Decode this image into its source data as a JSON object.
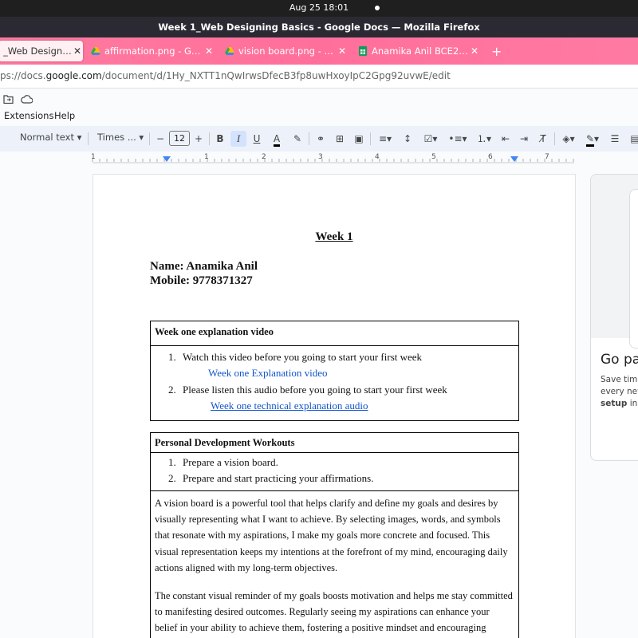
{
  "system": {
    "clock": "Aug 25  18:01"
  },
  "window": {
    "title": "Week 1_Web Designing Basics - Google Docs — Mozilla Firefox"
  },
  "tabs": [
    {
      "label": "_Web Designing B",
      "icon": "docs-icon",
      "active": true
    },
    {
      "label": "affirmation.png - Google",
      "icon": "drive-icon"
    },
    {
      "label": "vision board.png - Google",
      "icon": "drive-icon"
    },
    {
      "label": "Anamika Anil BCE210: Ma",
      "icon": "sheets-icon"
    }
  ],
  "urlbar": {
    "prefix": "ps://docs.",
    "domain": "google.com",
    "path": "/document/d/1Hy_NXTT1nQwIrwsDfecB3fp8uwHxoyIpC2Gpg92uvwE/edit"
  },
  "menus": [
    "Extensions",
    "Help"
  ],
  "toolbar": {
    "style": "Normal text",
    "font": "Times ...",
    "font_size": "12"
  },
  "ruler": {
    "numbers": [
      "1",
      "1",
      "2",
      "3",
      "4",
      "5",
      "6",
      "7"
    ]
  },
  "document": {
    "title": "Week 1",
    "name_line": "Name: Anamika Anil",
    "mobile_line": "Mobile: 9778371327",
    "table1": {
      "header": "Week one explanation video",
      "items": [
        {
          "num": "1.",
          "text": "Watch this video before you going to start your first week",
          "link": "Week one Explanation video"
        },
        {
          "num": "2.",
          "text": "Please listen this audio before you going to start your first week",
          "link": "Week one technical explanation audio"
        }
      ]
    },
    "table2": {
      "header": "Personal Development Workouts",
      "items": [
        {
          "num": "1.",
          "text": "Prepare a vision board."
        },
        {
          "num": "2.",
          "text": "Prepare and start practicing your affirmations."
        }
      ],
      "paragraphs": [
        "A vision board is a powerful tool that helps clarify and define my goals and desires by visually representing what I want to achieve. By selecting images, words, and symbols that resonate with my aspirations, I make my  goals more concrete and focused. This visual representation keeps my  intentions at the forefront of my mind, encouraging daily actions aligned with my long-term objectives.",
        "The constant visual reminder of my  goals boosts motivation and helps me  stay committed to manifesting desired outcomes. Regularly seeing my  aspirations can enhance your belief in your ability to achieve them, fostering a positive mindset and encouraging proactive steps."
      ]
    }
  },
  "side_panel": {
    "heading": "Go pag",
    "line1": "Save time",
    "line2": "every new",
    "line3_bold": "setup",
    "line3_rest": " in th"
  }
}
